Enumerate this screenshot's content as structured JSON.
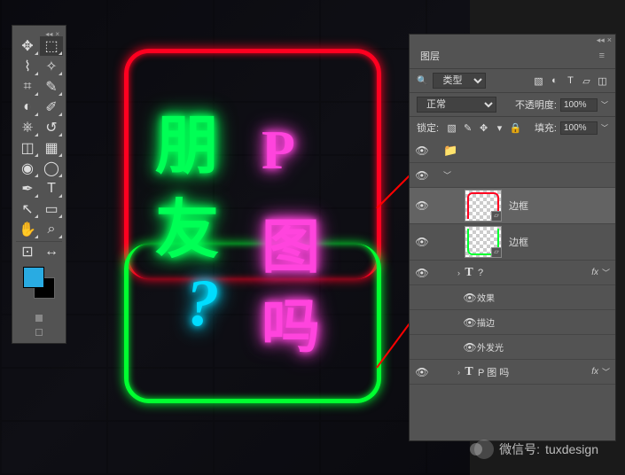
{
  "canvas_text": {
    "t1": "朋",
    "t2": "P",
    "t3": "友",
    "t4": "图",
    "t5": "?",
    "t6": "吗"
  },
  "toolbar": {
    "tools": [
      {
        "name": "move-tool",
        "glyph": "✥"
      },
      {
        "name": "marquee-tool",
        "glyph": "⬚"
      },
      {
        "name": "lasso-tool",
        "glyph": "⌇"
      },
      {
        "name": "magic-wand-tool",
        "glyph": "✧"
      },
      {
        "name": "crop-tool",
        "glyph": "⌗"
      },
      {
        "name": "eyedropper-tool",
        "glyph": "✎"
      },
      {
        "name": "healing-brush-tool",
        "glyph": "◐"
      },
      {
        "name": "brush-tool",
        "glyph": "✐"
      },
      {
        "name": "clone-stamp-tool",
        "glyph": "⎈"
      },
      {
        "name": "history-brush-tool",
        "glyph": "↺"
      },
      {
        "name": "eraser-tool",
        "glyph": "◫"
      },
      {
        "name": "gradient-tool",
        "glyph": "▦"
      },
      {
        "name": "blur-tool",
        "glyph": "◉"
      },
      {
        "name": "dodge-tool",
        "glyph": "◯"
      },
      {
        "name": "pen-tool",
        "glyph": "✒"
      },
      {
        "name": "type-tool",
        "glyph": "T"
      },
      {
        "name": "path-select-tool",
        "glyph": "↖"
      },
      {
        "name": "rectangle-tool",
        "glyph": "▭"
      },
      {
        "name": "hand-tool",
        "glyph": "✋"
      },
      {
        "name": "zoom-tool",
        "glyph": "⌕"
      }
    ],
    "fg_color": "#29abe2",
    "bg_color": "#000000"
  },
  "layers_panel": {
    "title": "图层",
    "filter_label": "类型",
    "blend_mode": "正常",
    "opacity_label": "不透明度:",
    "opacity_value": "100%",
    "lock_label": "锁定:",
    "fill_label": "填充:",
    "fill_value": "100%",
    "layers": [
      {
        "name": "边框",
        "type": "shape",
        "selected": true,
        "thumb": "red"
      },
      {
        "name": "边框",
        "type": "shape",
        "selected": false,
        "thumb": "green"
      },
      {
        "name": "?",
        "type": "text",
        "fx": true
      },
      {
        "name": "P 图 吗",
        "type": "text",
        "fx": true
      }
    ],
    "fx_label": "效果",
    "fx_items": [
      "描边",
      "外发光"
    ]
  },
  "watermark": {
    "label": "微信号:",
    "id": "tuxdesign"
  }
}
